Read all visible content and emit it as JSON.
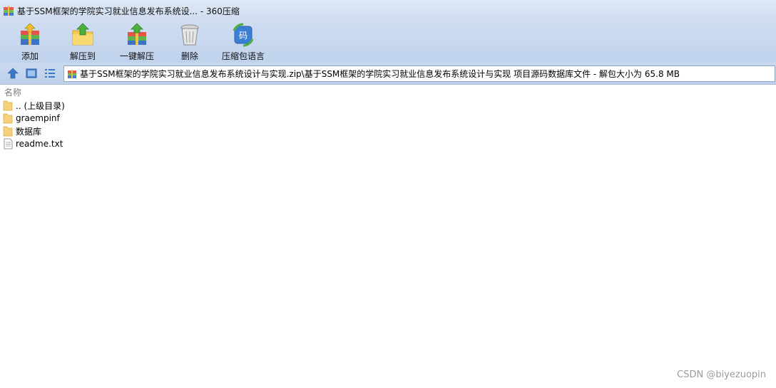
{
  "window": {
    "title": "基于SSM框架的学院实习就业信息发布系统设... - 360压缩"
  },
  "toolbar": {
    "items": [
      {
        "label": "添加",
        "icon": "add-archive-icon"
      },
      {
        "label": "解压到",
        "icon": "extract-to-icon"
      },
      {
        "label": "一键解压",
        "icon": "one-click-extract-icon"
      },
      {
        "label": "删除",
        "icon": "delete-trash-icon"
      },
      {
        "label": "压缩包语言",
        "icon": "archive-language-icon"
      }
    ]
  },
  "address": {
    "path": "基于SSM框架的学院实习就业信息发布系统设计与实现.zip\\基于SSM框架的学院实习就业信息发布系统设计与实现 项目源码数据库文件 - 解包大小为 65.8 MB"
  },
  "list": {
    "column_name": "名称",
    "rows": [
      {
        "name": ".. (上级目录)",
        "type": "folder"
      },
      {
        "name": "graempinf",
        "type": "folder"
      },
      {
        "name": "数据库",
        "type": "folder"
      },
      {
        "name": "readme.txt",
        "type": "text-file"
      }
    ]
  },
  "watermark": "CSDN @biyezuopin",
  "colors": {
    "toolbar_bg": "#c6d7ee",
    "folder": "#f5d27a",
    "selection_blue": "#3a78c9"
  }
}
